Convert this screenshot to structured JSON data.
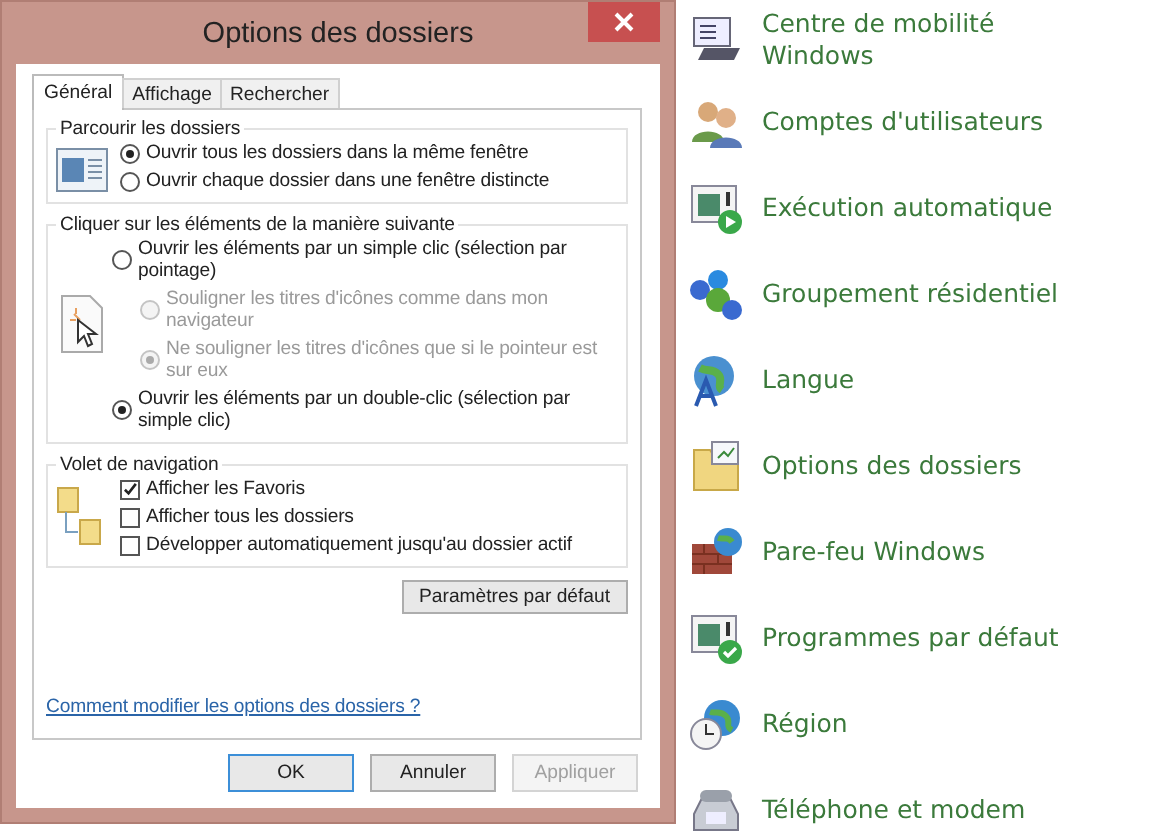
{
  "window": {
    "title": "Options des dossiers"
  },
  "tabs": [
    {
      "label": "Général",
      "selected": true
    },
    {
      "label": "Affichage",
      "selected": false
    },
    {
      "label": "Rechercher",
      "selected": false
    }
  ],
  "browse_group": {
    "title": "Parcourir les dossiers",
    "options": [
      {
        "label": "Ouvrir tous les dossiers dans la même fenêtre",
        "selected": true,
        "disabled": false
      },
      {
        "label": "Ouvrir chaque dossier dans une fenêtre distincte",
        "selected": false,
        "disabled": false
      }
    ]
  },
  "click_group": {
    "title": "Cliquer sur les éléments de la manière suivante",
    "options": [
      {
        "label": "Ouvrir les éléments par un simple clic (sélection par pointage)",
        "selected": false,
        "disabled": false,
        "sub": false
      },
      {
        "label": "Souligner les titres d'icônes comme dans mon navigateur",
        "selected": false,
        "disabled": true,
        "sub": true
      },
      {
        "label": "Ne souligner les titres d'icônes que si le pointeur est sur eux",
        "selected": true,
        "disabled": true,
        "sub": true
      },
      {
        "label": "Ouvrir les éléments par un double-clic (sélection par simple clic)",
        "selected": true,
        "disabled": false,
        "sub": false
      }
    ]
  },
  "nav_group": {
    "title": "Volet de navigation",
    "options": [
      {
        "label": "Afficher les Favoris",
        "checked": true
      },
      {
        "label": "Afficher tous les dossiers",
        "checked": false
      },
      {
        "label": "Développer automatiquement jusqu'au dossier actif",
        "checked": false
      }
    ]
  },
  "default_button": "Paramètres par défaut",
  "help_link": "Comment modifier les options des dossiers ?",
  "buttons": [
    {
      "label": "OK",
      "disabled": false,
      "default": true
    },
    {
      "label": "Annuler",
      "disabled": false,
      "default": false
    },
    {
      "label": "Appliquer",
      "disabled": true,
      "default": false
    }
  ],
  "control_panel_items": [
    {
      "label": "Centre de mobilité Windows"
    },
    {
      "label": "Comptes d'utilisateurs"
    },
    {
      "label": "Exécution automatique"
    },
    {
      "label": "Groupement résidentiel"
    },
    {
      "label": "Langue"
    },
    {
      "label": "Options des dossiers"
    },
    {
      "label": "Pare-feu Windows"
    },
    {
      "label": "Programmes par défaut"
    },
    {
      "label": "Région"
    },
    {
      "label": "Téléphone et modem"
    }
  ]
}
